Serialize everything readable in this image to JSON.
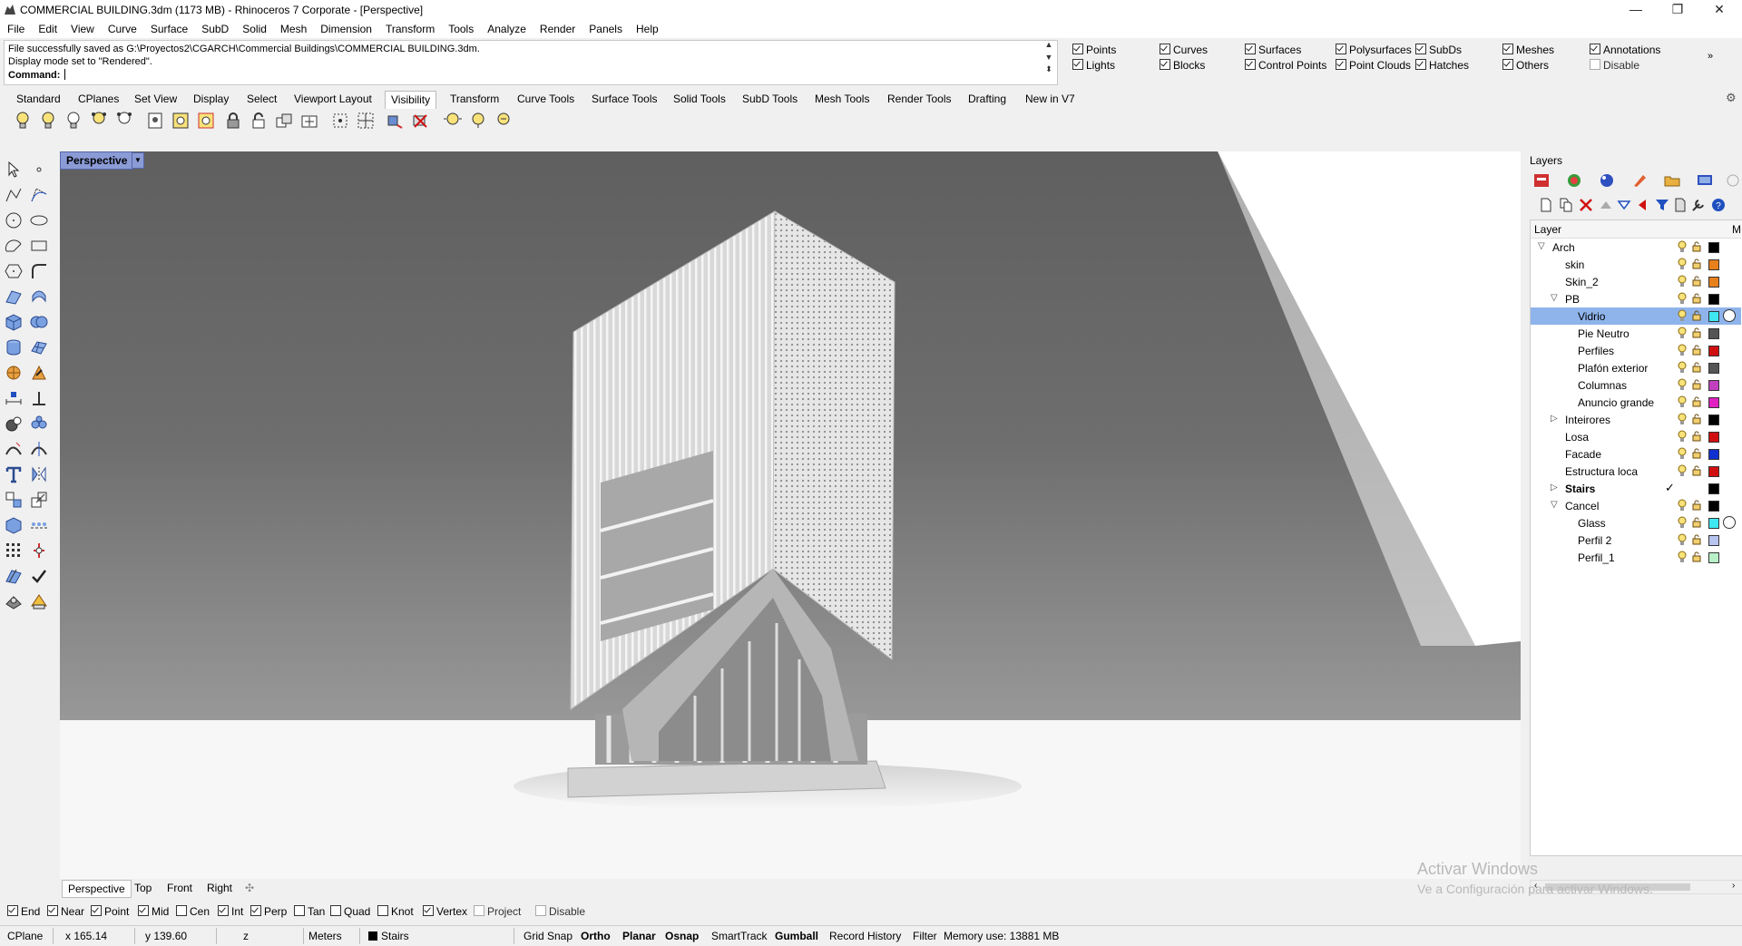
{
  "window": {
    "title": "COMMERCIAL BUILDING.3dm (1173 MB) - Rhinoceros 7 Corporate - [Perspective]",
    "minimize": "—",
    "maximize": "❐",
    "close": "✕"
  },
  "menu": [
    "File",
    "Edit",
    "View",
    "Curve",
    "Surface",
    "SubD",
    "Solid",
    "Mesh",
    "Dimension",
    "Transform",
    "Tools",
    "Analyze",
    "Render",
    "Panels",
    "Help"
  ],
  "command": {
    "history_1": "File successfully saved as G:\\Proyectos2\\CGARCH\\Commercial Buildings\\COMMERCIAL BUILDING.3dm.",
    "history_2": "Display mode set to \"Rendered\".",
    "prompt": "Command:"
  },
  "filters": [
    {
      "label": "Points",
      "checked": true
    },
    {
      "label": "Curves",
      "checked": true
    },
    {
      "label": "Surfaces",
      "checked": true
    },
    {
      "label": "Polysurfaces",
      "checked": true
    },
    {
      "label": "SubDs",
      "checked": true
    },
    {
      "label": "Meshes",
      "checked": true
    },
    {
      "label": "Annotations",
      "checked": true
    },
    {
      "label": "Lights",
      "checked": true
    },
    {
      "label": "Blocks",
      "checked": true
    },
    {
      "label": "Control Points",
      "checked": true
    },
    {
      "label": "Point Clouds",
      "checked": true
    },
    {
      "label": "Hatches",
      "checked": true
    },
    {
      "label": "Others",
      "checked": true
    },
    {
      "label": "Disable",
      "checked": false
    }
  ],
  "toolbar_tabs": [
    "Standard",
    "CPlanes",
    "Set View",
    "Display",
    "Select",
    "Viewport Layout",
    "Visibility",
    "Transform",
    "Curve Tools",
    "Surface Tools",
    "Solid Tools",
    "SubD Tools",
    "Mesh Tools",
    "Render Tools",
    "Drafting",
    "New in V7"
  ],
  "active_tab": "Visibility",
  "viewport": {
    "label": "Perspective",
    "display_mode": "Rendered"
  },
  "viewport_tabs": [
    "Perspective",
    "Top",
    "Front",
    "Right"
  ],
  "osnaps": [
    {
      "label": "End",
      "checked": true
    },
    {
      "label": "Near",
      "checked": true
    },
    {
      "label": "Point",
      "checked": true
    },
    {
      "label": "Mid",
      "checked": true
    },
    {
      "label": "Cen",
      "checked": false
    },
    {
      "label": "Int",
      "checked": true
    },
    {
      "label": "Perp",
      "checked": true
    },
    {
      "label": "Tan",
      "checked": false
    },
    {
      "label": "Quad",
      "checked": false
    },
    {
      "label": "Knot",
      "checked": false
    },
    {
      "label": "Vertex",
      "checked": true
    },
    {
      "label": "Project",
      "checked": false
    },
    {
      "label": "Disable",
      "checked": false
    }
  ],
  "status": {
    "cplane": "CPlane",
    "x": "x 165.14",
    "y": "y 139.60",
    "z": "z",
    "units": "Meters",
    "layer": "Stairs",
    "grid_snap": "Grid Snap",
    "ortho": "Ortho",
    "planar": "Planar",
    "osnap": "Osnap",
    "smarttrack": "SmartTrack",
    "gumball": "Gumball",
    "record_history": "Record History",
    "filter": "Filter",
    "memory": "Memory use: 13881 MB"
  },
  "layers_panel": {
    "title": "Layers",
    "column_layer": "Layer",
    "column_material": "M",
    "rows": [
      {
        "name": "Arch",
        "indent": 0,
        "expand": "open",
        "color": "#000000",
        "bold": false,
        "selected": false,
        "current": false
      },
      {
        "name": "skin",
        "indent": 1,
        "expand": "",
        "color": "#e8801c",
        "bold": false,
        "selected": false,
        "current": false
      },
      {
        "name": "Skin_2",
        "indent": 1,
        "expand": "",
        "color": "#e8801c",
        "bold": false,
        "selected": false,
        "current": false
      },
      {
        "name": "PB",
        "indent": 1,
        "expand": "open",
        "color": "#000000",
        "bold": false,
        "selected": false,
        "current": false
      },
      {
        "name": "Vidrio",
        "indent": 2,
        "expand": "",
        "color": "#3ee8f0",
        "bold": false,
        "selected": true,
        "current": false,
        "material": true
      },
      {
        "name": "Pie Neutro",
        "indent": 2,
        "expand": "",
        "color": "#555555",
        "bold": false,
        "selected": false,
        "current": false
      },
      {
        "name": "Perfiles",
        "indent": 2,
        "expand": "",
        "color": "#d01010",
        "bold": false,
        "selected": false,
        "current": false
      },
      {
        "name": "Plafón exterior",
        "indent": 2,
        "expand": "",
        "color": "#555555",
        "bold": false,
        "selected": false,
        "current": false
      },
      {
        "name": "Columnas",
        "indent": 2,
        "expand": "",
        "color": "#c040c0",
        "bold": false,
        "selected": false,
        "current": false
      },
      {
        "name": "Anuncio grande",
        "indent": 2,
        "expand": "",
        "color": "#e020c0",
        "bold": false,
        "selected": false,
        "current": false
      },
      {
        "name": "Inteirores",
        "indent": 1,
        "expand": "closed",
        "color": "#000000",
        "bold": false,
        "selected": false,
        "current": false
      },
      {
        "name": "Losa",
        "indent": 1,
        "expand": "",
        "color": "#d01010",
        "bold": false,
        "selected": false,
        "current": false
      },
      {
        "name": "Facade",
        "indent": 1,
        "expand": "",
        "color": "#1030d0",
        "bold": false,
        "selected": false,
        "current": false
      },
      {
        "name": "Estructura loca",
        "indent": 1,
        "expand": "",
        "color": "#d01010",
        "bold": false,
        "selected": false,
        "current": false
      },
      {
        "name": "Stairs",
        "indent": 1,
        "expand": "closed",
        "color": "#000000",
        "bold": true,
        "selected": false,
        "current": true
      },
      {
        "name": "Cancel",
        "indent": 1,
        "expand": "open",
        "color": "#000000",
        "bold": false,
        "selected": false,
        "current": false
      },
      {
        "name": "Glass",
        "indent": 2,
        "expand": "",
        "color": "#3ee8f0",
        "bold": false,
        "selected": false,
        "current": false,
        "material": true
      },
      {
        "name": "Perfil 2",
        "indent": 2,
        "expand": "",
        "color": "#b8c4f0",
        "bold": false,
        "selected": false,
        "current": false
      },
      {
        "name": "Perfil_1",
        "indent": 2,
        "expand": "",
        "color": "#b8f0c8",
        "bold": false,
        "selected": false,
        "current": false
      }
    ]
  },
  "watermark": {
    "line1": "Activar Windows",
    "line2": "Ve a Configuración para activar Windows."
  },
  "colors": {
    "viewport_label_bg": "#8a9bd6",
    "selected_layer_bg": "#8fb4ec"
  }
}
